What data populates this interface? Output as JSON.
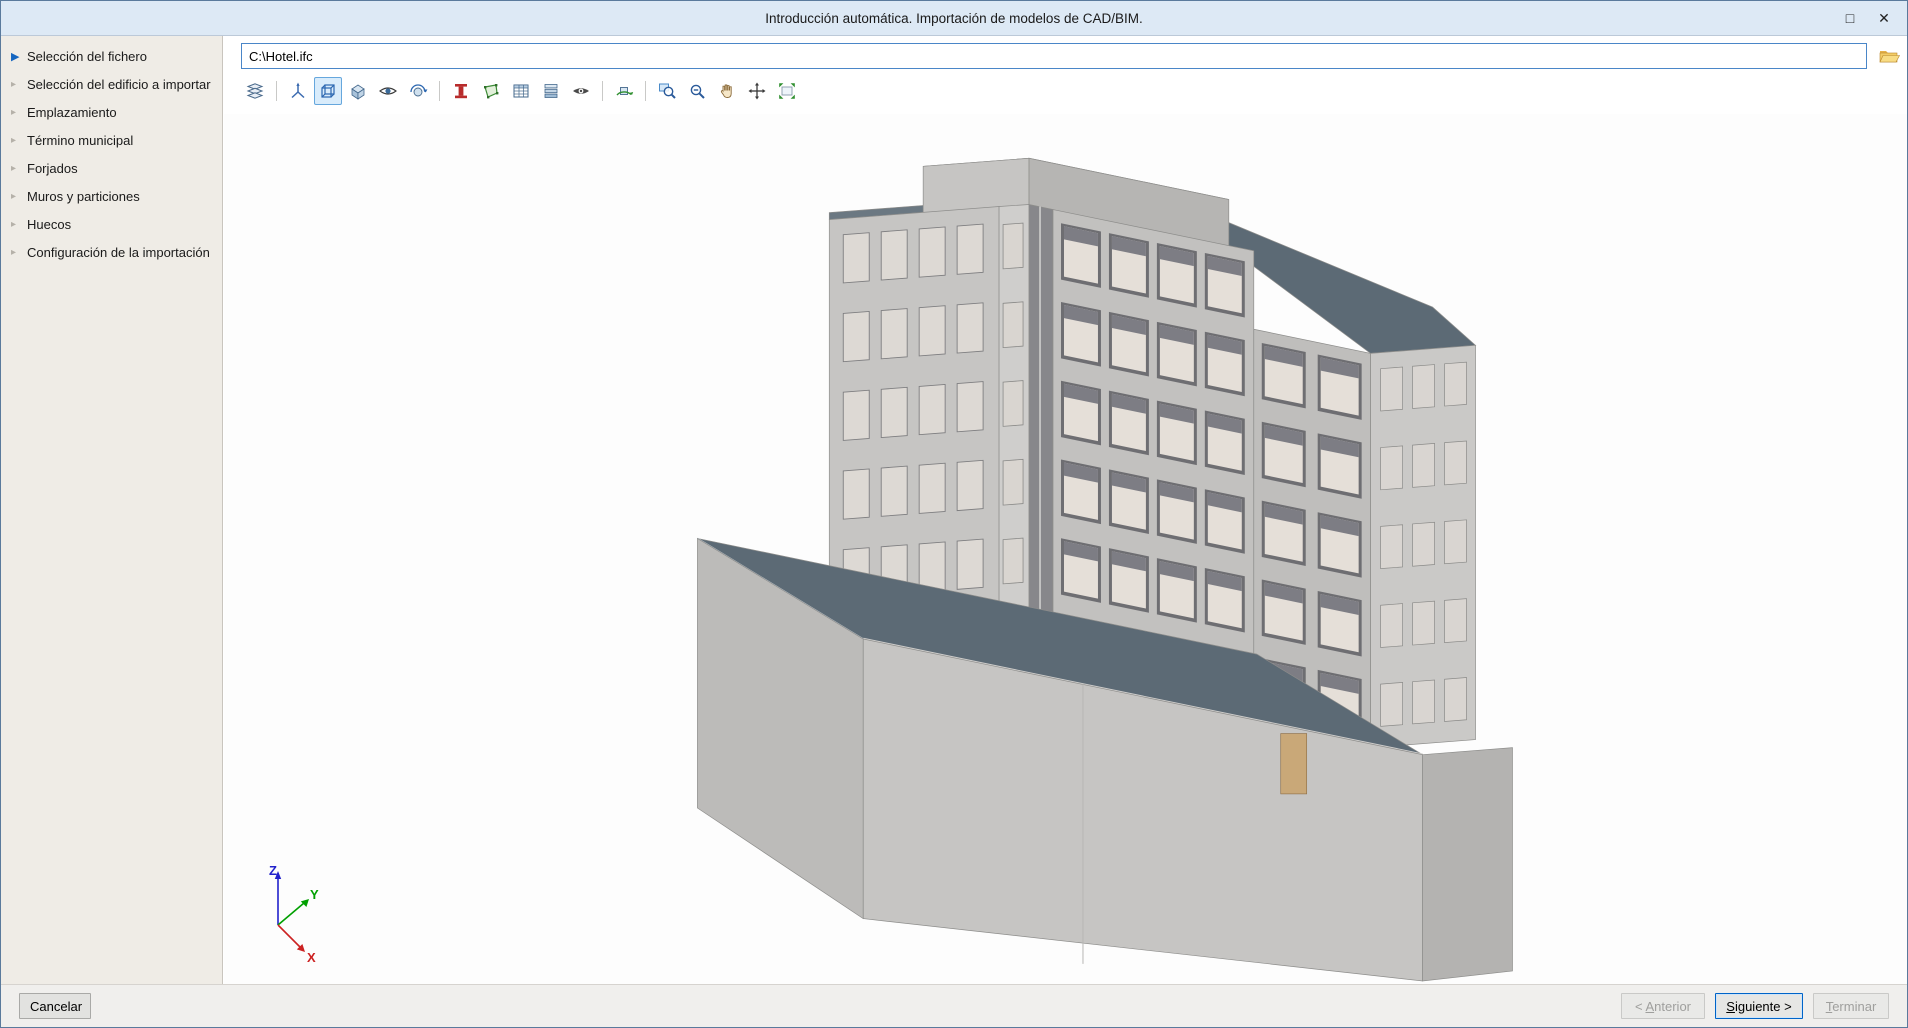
{
  "window": {
    "title": "Introducción automática. Importación de modelos de CAD/BIM.",
    "controls": {
      "maximize": "□",
      "close": "✕"
    }
  },
  "sidebar": {
    "active_index": 0,
    "items": [
      {
        "label": "Selección del fichero"
      },
      {
        "label": "Selección del edificio a importar"
      },
      {
        "label": "Emplazamiento"
      },
      {
        "label": "Término municipal"
      },
      {
        "label": "Forjados"
      },
      {
        "label": "Muros y particiones"
      },
      {
        "label": "Huecos"
      },
      {
        "label": "Configuración de la importación"
      }
    ]
  },
  "file": {
    "path": "C:\\Hotel.ifc"
  },
  "toolbar": {
    "active_icon": "view-3d",
    "icons": [
      "layers",
      "ucs-axes",
      "view-3d",
      "solid-view",
      "eye",
      "orbit",
      "column-red",
      "area-green",
      "table",
      "layers-stack",
      "hide-elements",
      "rotate-3d",
      "zoom-window",
      "zoom-out",
      "pan",
      "center",
      "fit-window"
    ]
  },
  "viewport": {
    "axes": {
      "x": "X",
      "y": "Y",
      "z": "Z"
    },
    "axis_colors": {
      "x": "#cc2222",
      "y": "#00a000",
      "z": "#2222cc"
    }
  },
  "footer": {
    "cancel": "Cancelar",
    "previous": "< Anterior",
    "next": "Siguiente >",
    "finish": "Terminar",
    "access_keys": {
      "previous": "A",
      "next": "S",
      "finish": "T"
    }
  },
  "colors": {
    "accent": "#0a64c8",
    "titlebar_bg": "#dde9f5",
    "sidebar_bg": "#efece6",
    "roof": "#5c6a75",
    "wall": "#c6c5c3"
  }
}
